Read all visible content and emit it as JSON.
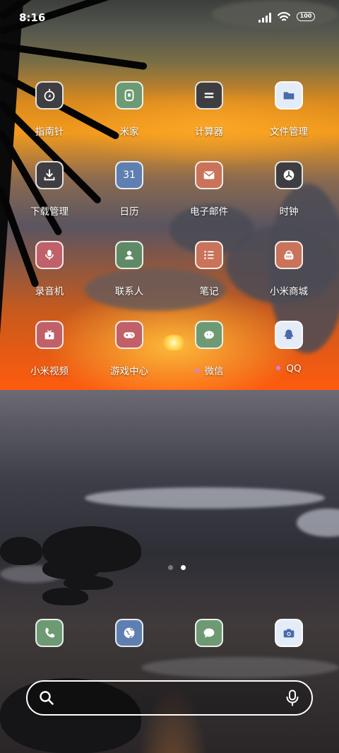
{
  "status_bar": {
    "time": "8:16",
    "battery": "100"
  },
  "apps": [
    {
      "label": "指南针",
      "icon": "compass-icon",
      "color": "#3f3f42"
    },
    {
      "label": "米家",
      "icon": "mijia-icon",
      "color": "#6d9a72"
    },
    {
      "label": "计算器",
      "icon": "calculator-icon",
      "color": "#3e3e42"
    },
    {
      "label": "文件管理",
      "icon": "folder-icon",
      "color": "#e4ecf8"
    },
    {
      "label": "下载管理",
      "icon": "download-icon",
      "color": "#3e3e42"
    },
    {
      "label": "日历",
      "icon": "calendar-icon",
      "color": "#5f7fb0",
      "badge_text": "31"
    },
    {
      "label": "电子邮件",
      "icon": "mail-icon",
      "color": "#c9735a"
    },
    {
      "label": "时钟",
      "icon": "clock-icon",
      "color": "#3e3e42"
    },
    {
      "label": "录音机",
      "icon": "microphone-icon",
      "color": "#c06068"
    },
    {
      "label": "联系人",
      "icon": "contact-icon",
      "color": "#5f8a66"
    },
    {
      "label": "笔记",
      "icon": "notes-icon",
      "color": "#c9735a"
    },
    {
      "label": "小米商城",
      "icon": "shopping-basket-icon",
      "color": "#c9735a"
    },
    {
      "label": "小米视频",
      "icon": "video-icon",
      "color": "#c06068"
    },
    {
      "label": "游戏中心",
      "icon": "gamepad-icon",
      "color": "#c06068"
    },
    {
      "label": "微信",
      "icon": "wechat-icon",
      "color": "#6d9a72",
      "new_dot": true
    },
    {
      "label": "QQ",
      "icon": "qq-icon",
      "color": "#e4ecf8",
      "new_dot": true
    }
  ],
  "dock": [
    {
      "name": "phone-icon",
      "color": "#6d9a72"
    },
    {
      "name": "browser-icon",
      "color": "#5f7fb0"
    },
    {
      "name": "messages-icon",
      "color": "#6d9a72"
    },
    {
      "name": "camera-icon",
      "color": "#e4ecf8"
    }
  ],
  "pager": {
    "pages": 2,
    "current": 2
  },
  "search": {
    "search_icon": "search-icon",
    "mic_icon": "microphone-icon"
  }
}
